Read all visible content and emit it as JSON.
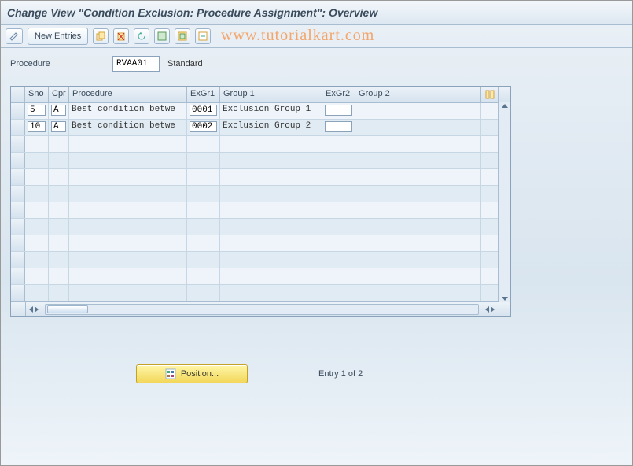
{
  "title": "Change View \"Condition Exclusion: Procedure Assignment\": Overview",
  "toolbar": {
    "new_entries": "New Entries"
  },
  "watermark": "www.tutorialkart.com",
  "header": {
    "procedure_label": "Procedure",
    "procedure_code": "RVAA01",
    "procedure_desc": "Standard"
  },
  "grid": {
    "columns": {
      "sno": "Sno",
      "cpr": "Cpr",
      "proc": "Procedure",
      "exgr1": "ExGr1",
      "g1": "Group 1",
      "exgr2": "ExGr2",
      "g2": "Group 2"
    },
    "rows": [
      {
        "sno": "5",
        "cpr": "A",
        "proc": "Best condition betwe",
        "exgr1": "0001",
        "g1": "Exclusion Group 1",
        "exgr2": "",
        "g2": ""
      },
      {
        "sno": "10",
        "cpr": "A",
        "proc": "Best condition betwe",
        "exgr1": "0002",
        "g1": "Exclusion Group 2",
        "exgr2": "",
        "g2": ""
      }
    ],
    "empty_rows": 10
  },
  "footer": {
    "position_label": "Position...",
    "entry_text": "Entry 1 of 2"
  }
}
